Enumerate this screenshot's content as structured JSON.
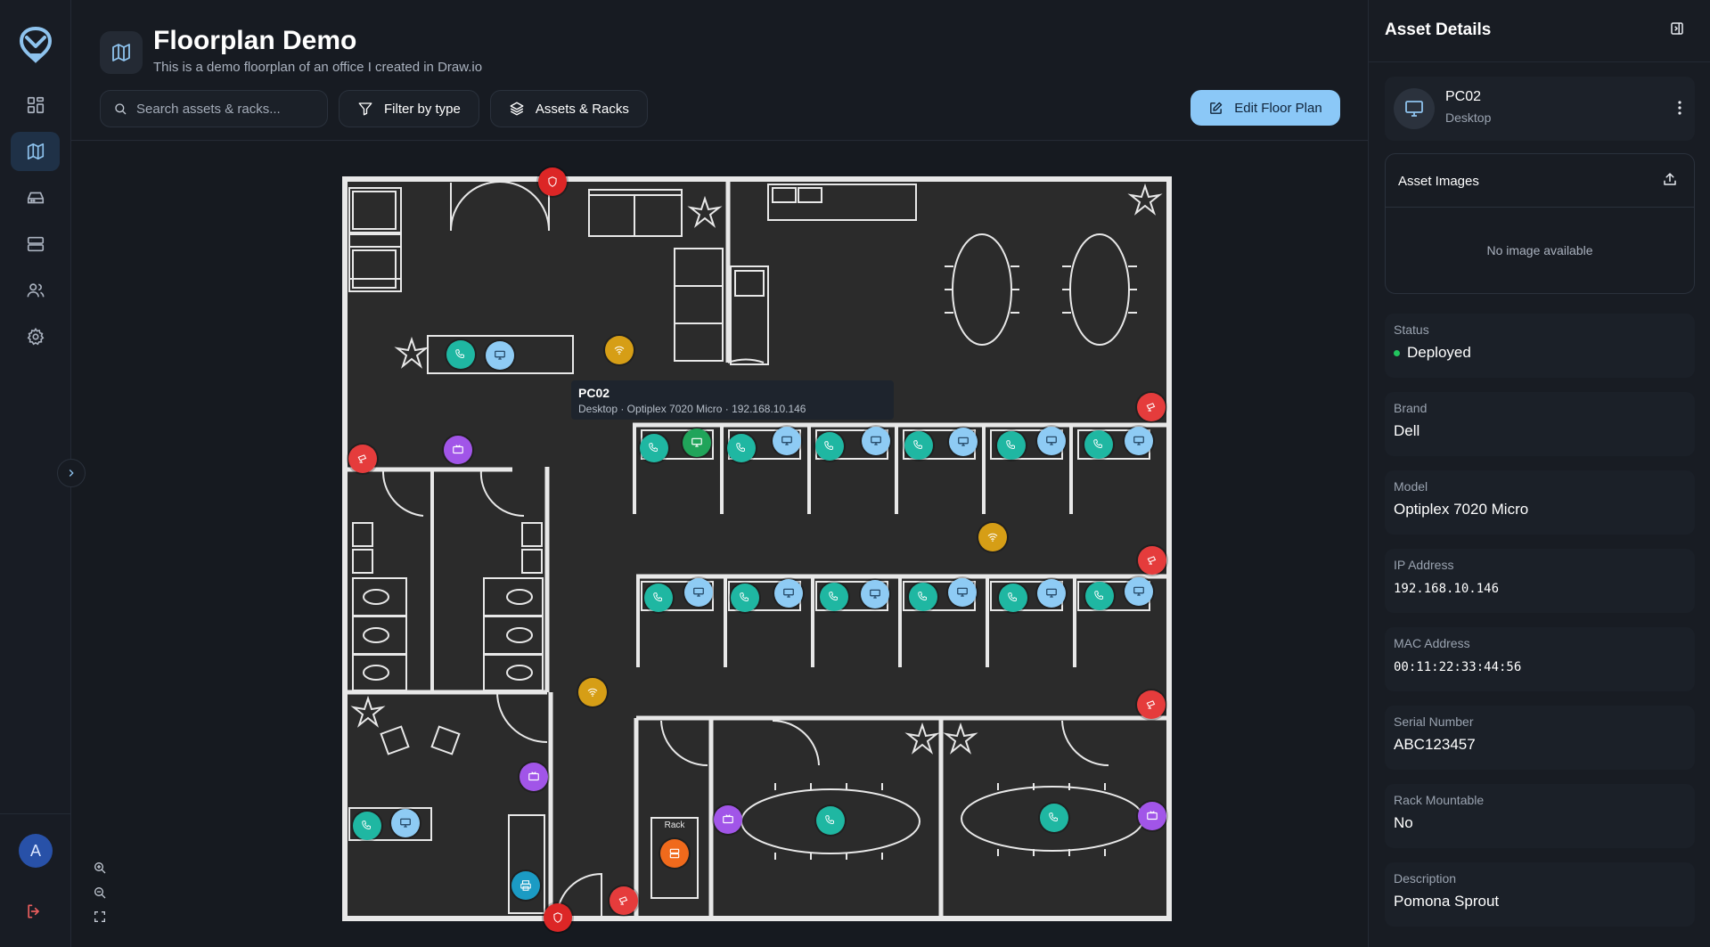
{
  "header": {
    "title": "Floorplan Demo",
    "subtitle": "This is a demo floorplan of an office I created in Draw.io",
    "search_placeholder": "Search assets & racks...",
    "filter_label": "Filter by type",
    "layers_label": "Assets & Racks",
    "edit_label": "Edit Floor Plan"
  },
  "sidebar": {
    "items": [
      {
        "icon": "dashboard-icon",
        "active": false
      },
      {
        "icon": "map-icon",
        "active": true
      },
      {
        "icon": "hard-drive-icon",
        "active": false
      },
      {
        "icon": "server-icon",
        "active": false
      },
      {
        "icon": "users-icon",
        "active": false
      },
      {
        "icon": "gear-icon",
        "active": false
      }
    ],
    "avatar_initial": "A"
  },
  "floorplan": {
    "rack_label": "Rack",
    "tooltip": {
      "title": "PC02",
      "subtitle": "Desktop · Optiplex 7020 Micro · 192.168.10.146"
    }
  },
  "panel": {
    "title": "Asset Details",
    "asset": {
      "name": "PC02",
      "type": "Desktop"
    },
    "images_title": "Asset Images",
    "no_image": "No image available",
    "fields": [
      {
        "label": "Status",
        "value": "Deployed"
      },
      {
        "label": "Brand",
        "value": "Dell"
      },
      {
        "label": "Model",
        "value": "Optiplex 7020 Micro"
      },
      {
        "label": "IP Address",
        "value": "192.168.10.146"
      },
      {
        "label": "MAC Address",
        "value": "00:11:22:33:44:56"
      },
      {
        "label": "Serial Number",
        "value": "ABC123457"
      },
      {
        "label": "Rack Mountable",
        "value": "No"
      },
      {
        "label": "Description",
        "value": "Pomona Sprout"
      }
    ]
  },
  "colors": {
    "accent": "#8bc8f7",
    "phone": "#1fb7a2",
    "pc": "#8ecbf4",
    "pc_selected": "#20a45a",
    "wifi": "#d69e16",
    "camera": "#e53c3c",
    "tv": "#a155e8",
    "rack": "#f06a1c",
    "printer": "#1b9bc4",
    "status_ok": "#22c55e"
  }
}
